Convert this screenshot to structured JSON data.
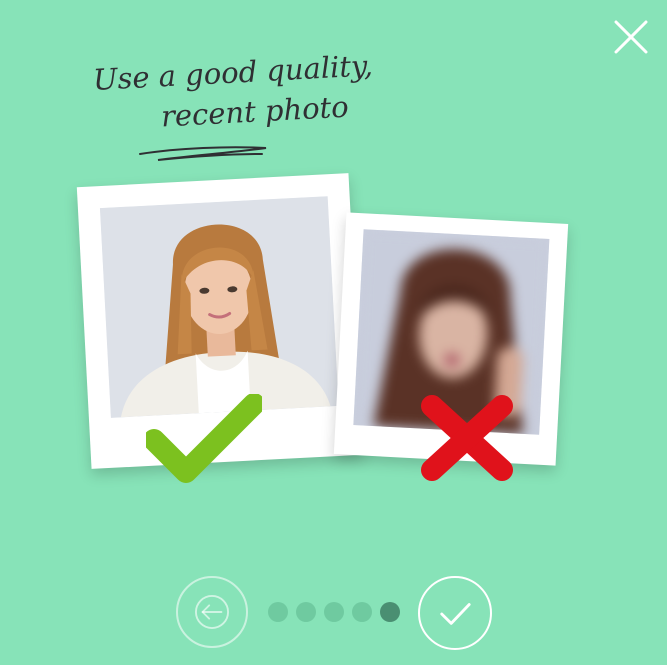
{
  "headline": {
    "line1": "Use a good quality,",
    "line2": "recent photo"
  },
  "photos": {
    "good_label_icon": "checkmark-icon",
    "bad_label_icon": "x-icon"
  },
  "pagination": {
    "total": 5,
    "current": 5
  },
  "colors": {
    "background": "#87e3b8",
    "good": "#7cc11f",
    "bad": "#e0121b",
    "dot_inactive": "#6fcaa0",
    "dot_active": "#4a8f72"
  },
  "icons": {
    "close": "close-icon",
    "prev": "arrow-left-icon",
    "next": "checkmark-icon"
  }
}
